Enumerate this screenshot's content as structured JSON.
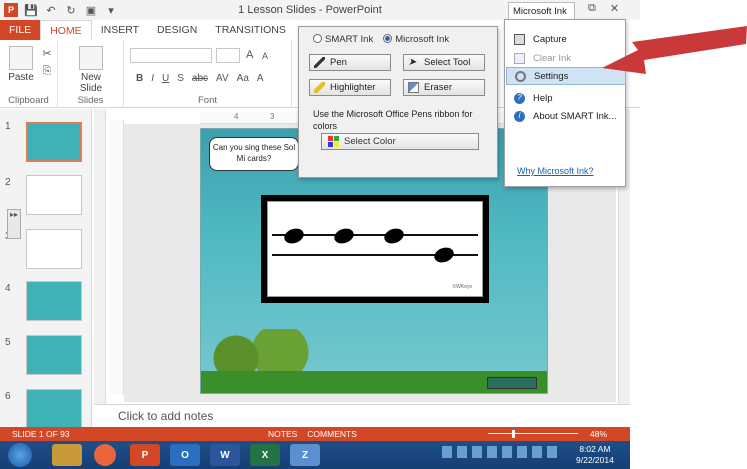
{
  "window": {
    "title": "1 Lesson Slides - PowerPoint",
    "controls": {
      "restore": "⧉",
      "close": "✕"
    }
  },
  "tabs": [
    "FILE",
    "HOME",
    "INSERT",
    "DESIGN",
    "TRANSITIONS",
    "ANI"
  ],
  "ribbon": {
    "clipboard": {
      "paste": "Paste",
      "label": "Clipboard"
    },
    "slides": {
      "new_slide": "New",
      "new_slide_2": "Slide",
      "label": "Slides"
    },
    "font": {
      "label": "Font",
      "format_buttons": [
        "B",
        "I",
        "U",
        "S",
        "abc",
        "AV",
        "Aa",
        "A"
      ],
      "grow": "A",
      "shrink": "A"
    }
  },
  "thumbnails": [
    {
      "num": "1",
      "style": "white"
    },
    {
      "num": "2",
      "style": "white"
    },
    {
      "num": "3",
      "style": "white"
    },
    {
      "num": "4",
      "style": "teal"
    },
    {
      "num": "5",
      "style": "teal"
    },
    {
      "num": "6",
      "style": "teal"
    }
  ],
  "ruler": {
    "marks": [
      "4",
      "3"
    ]
  },
  "slide": {
    "speech": "Can you sing these Sol Mi cards?",
    "credit": "©WKeys"
  },
  "notes_placeholder": "Click to add notes",
  "status": {
    "slide_info": "SLIDE 1 OF 93",
    "notes": "NOTES",
    "comments": "COMMENTS",
    "zoom": "48%"
  },
  "taskbar": {
    "apps": [
      "",
      "",
      "",
      "P",
      "O",
      "W",
      "X",
      "Z"
    ],
    "time": "8:02 AM",
    "date": "9/22/2014"
  },
  "ink_dialog": {
    "mode_smart": "SMART Ink",
    "mode_microsoft": "Microsoft Ink",
    "pen": "Pen",
    "select_tool": "Select Tool",
    "highlighter": "Highlighter",
    "eraser": "Eraser",
    "note": "Use the Microsoft Office Pens ribbon for colors",
    "select_color": "Select Color"
  },
  "ink_menu": {
    "tab": "Microsoft Ink",
    "items": [
      {
        "label": "Capture",
        "state": "normal"
      },
      {
        "label": "Clear Ink",
        "state": "disabled"
      },
      {
        "label": "Settings",
        "state": "highlighted"
      },
      {
        "label": "Help",
        "state": "normal"
      },
      {
        "label": "About SMART Ink...",
        "state": "normal"
      }
    ],
    "link": "Why Microsoft Ink?"
  },
  "colors": {
    "accent": "#d24726",
    "arrow": "#c9393a",
    "slide_bg": "#4fb9c2",
    "menu_highlight": "#cfe2f6",
    "taskbar": "#1e4e8a"
  }
}
